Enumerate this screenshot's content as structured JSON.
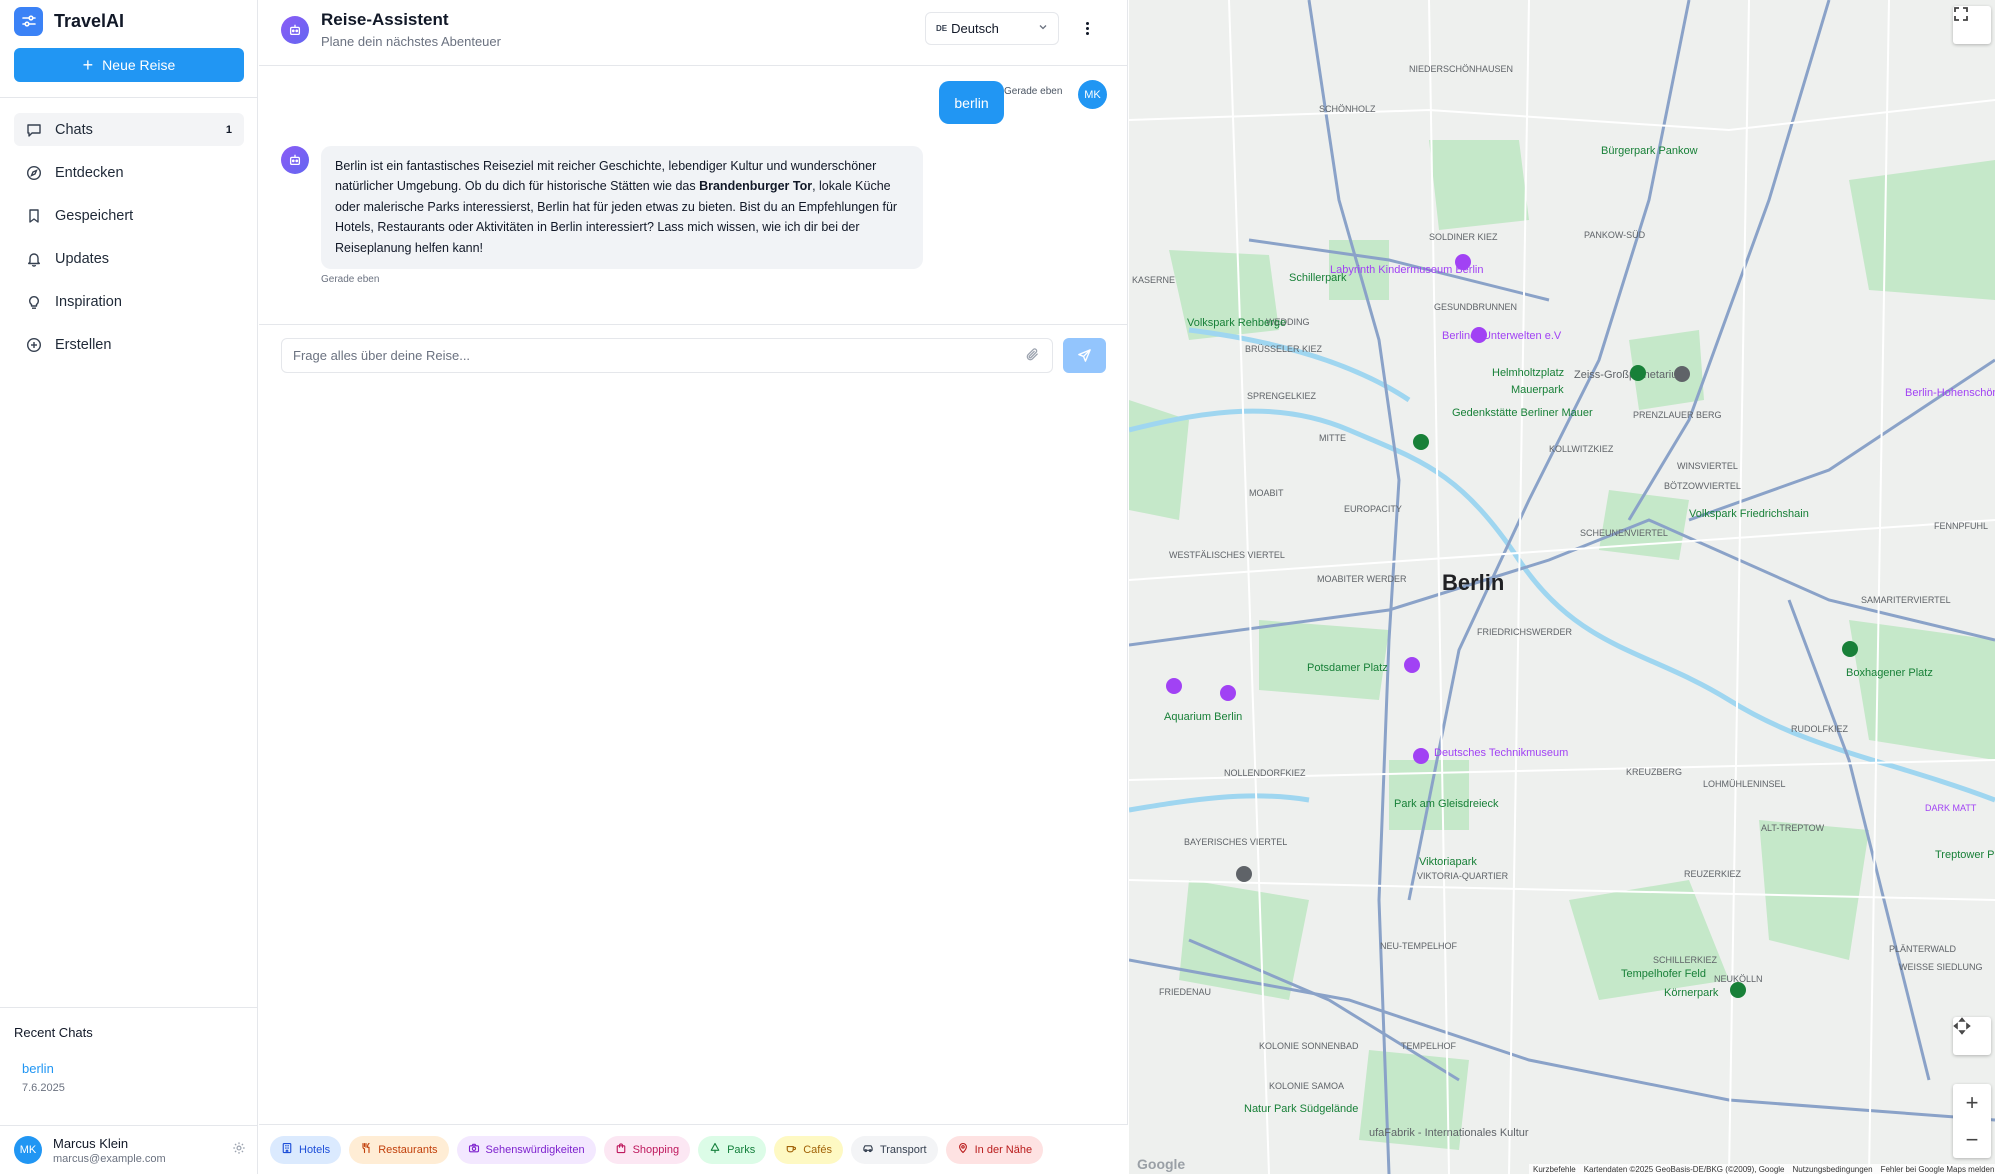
{
  "app": {
    "name": "TravelAI"
  },
  "sidebar": {
    "new_trip_label": "Neue Reise",
    "items": [
      {
        "label": "Chats",
        "icon": "message-square-icon",
        "count": "1"
      },
      {
        "label": "Entdecken",
        "icon": "compass-icon"
      },
      {
        "label": "Gespeichert",
        "icon": "bookmark-icon"
      },
      {
        "label": "Updates",
        "icon": "bell-icon"
      },
      {
        "label": "Inspiration",
        "icon": "lightbulb-icon"
      },
      {
        "label": "Erstellen",
        "icon": "plus-circle-icon"
      }
    ],
    "recent_title": "Recent Chats",
    "recent": [
      {
        "title": "berlin",
        "date": "7.6.2025"
      }
    ],
    "user": {
      "initials": "MK",
      "name": "Marcus Klein",
      "email": "marcus@example.com"
    }
  },
  "chat": {
    "title": "Reise-Assistent",
    "subtitle": "Plane dein nächstes Abenteuer",
    "language": {
      "flag": "DE",
      "label": "Deutsch"
    },
    "messages": {
      "user": {
        "text": "berlin",
        "time": "Gerade eben",
        "initials": "MK"
      },
      "bot": {
        "part1": "Berlin ist ein fantastisches Reiseziel mit reicher Geschichte, lebendiger Kultur und wunderschöner natürlicher Umgebung. Ob du dich für historische Stätten wie das ",
        "bold": "Brandenburger Tor",
        "part2": ", lokale Küche oder malerische Parks interessierst, Berlin hat für jeden etwas zu bieten. Bist du an Empfehlungen für Hotels, Restaurants oder Aktivitäten in Berlin interessiert? Lass mich wissen, wie ich dir bei der Reiseplanung helfen kann!",
        "time": "Gerade eben"
      }
    },
    "input": {
      "placeholder": "Frage alles über deine Reise...",
      "value": ""
    },
    "categories": [
      {
        "label": "Hotels",
        "icon": "building-icon",
        "bg": "#dbeafe",
        "fg": "#1d4ed8"
      },
      {
        "label": "Restaurants",
        "icon": "utensils-icon",
        "bg": "#ffedd5",
        "fg": "#c2410c"
      },
      {
        "label": "Sehenswürdigkeiten",
        "icon": "camera-icon",
        "bg": "#f3e8ff",
        "fg": "#7e22ce"
      },
      {
        "label": "Shopping",
        "icon": "shopping-bag-icon",
        "bg": "#fce7f3",
        "fg": "#be185d"
      },
      {
        "label": "Parks",
        "icon": "tree-icon",
        "bg": "#dcfce7",
        "fg": "#15803d"
      },
      {
        "label": "Cafés",
        "icon": "coffee-icon",
        "bg": "#fef9c3",
        "fg": "#a16207"
      },
      {
        "label": "Transport",
        "icon": "car-icon",
        "bg": "#f3f4f6",
        "fg": "#374151"
      },
      {
        "label": "In der Nähe",
        "icon": "map-pin-icon",
        "bg": "#fee2e2",
        "fg": "#b91c1c"
      }
    ]
  },
  "map": {
    "city": "Berlin",
    "districts": [
      "SCHÖNHOLZ",
      "PANKOW-SÜD",
      "SOLDINER KIEZ",
      "GESUNDBRUNNEN",
      "WEDDING",
      "KOLLWITZKIEZ",
      "WINSVIERTEL",
      "BÖTZOWVIERTEL",
      "EUROPACITY",
      "MOABITER WERDER",
      "SCHEUNENVIERTEL",
      "FRIEDRICHSWERDER",
      "SAMARITERVIERTEL",
      "NOLLENDORFKIEZ",
      "KREUZBERG",
      "LOHMÜHLENINSEL",
      "RUDOLFKIEZ",
      "BAYERISCHES VIERTEL",
      "VIKTORIA-QUARTIER",
      "REUZERKIEZ",
      "NEU-TEMPELHOF",
      "SCHILLERKIEZ",
      "KOLONIE SONNENBAD",
      "KOLONIE SAMOA",
      "WESTFÄLISCHES VIERTEL",
      "MOABIT",
      "KASERNE",
      "MITTE",
      "SPRENGELKIEZ",
      "BRÜSSELER KIEZ",
      "NIEDERSCHÖNHAUSEN",
      "WEISSE SIEDLUNG",
      "FRIEDENAU",
      "TEMPELHOF",
      "NEUKÖLLN",
      "FENNPFUHL",
      "ALT-TREPTOW",
      "PLÄNTERWALD",
      "PRENZLAUER BERG",
      "DARK MATT"
    ],
    "places": [
      "Bürgerpark Pankow",
      "Labyrinth Kindermuseum Berlin",
      "Schillerpark",
      "Volkspark Rehberge",
      "Berliner Unterwelten e.V",
      "Helmholtzplatz",
      "Mauerpark",
      "Zeiss-Großplanetarium",
      "Gedenkstätte Berliner Mauer",
      "Volkspark Friedrichshain",
      "Potsdamer Platz",
      "Aquarium Berlin",
      "Deutsches Technikmuseum",
      "Park am Gleisdreieck",
      "Viktoriapark",
      "Tempelhofer Feld",
      "Körnerpark",
      "Boxhagener Platz",
      "Treptower Park",
      "Natur Park Südgelände",
      "ufaFabrik - Internationales Kultur",
      "Berlin-Hohenschönhausen"
    ],
    "footer": [
      "Kurzbefehle",
      "Kartendaten ©2025 GeoBasis-DE/BKG (©2009), Google",
      "Nutzungsbedingungen",
      "Fehler bei Google Maps melden"
    ],
    "google_label": "Google"
  }
}
